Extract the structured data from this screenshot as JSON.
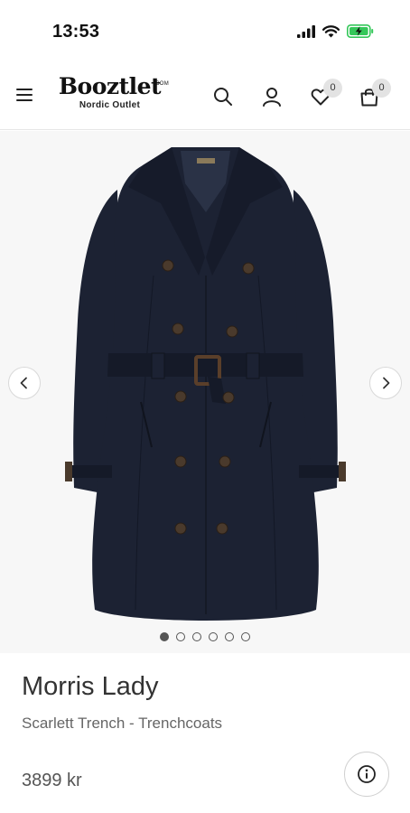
{
  "status_bar": {
    "time": "13:53",
    "icons": [
      "signal-icon",
      "wifi-icon",
      "battery-charging-icon"
    ],
    "battery_color": "#34c759"
  },
  "header": {
    "logo_text": "Booztlet",
    "logo_com": ".COM",
    "logo_subtitle": "Nordic Outlet",
    "wishlist_count": "0",
    "cart_count": "0",
    "icons": [
      "menu-icon",
      "search-icon",
      "account-icon",
      "heart-icon",
      "bag-icon"
    ]
  },
  "gallery": {
    "image_alt": "navy trench coat",
    "coat_color": "#1c2233",
    "background": "#f7f7f7",
    "dot_count": 6,
    "active_dot": 0
  },
  "product": {
    "brand": "Morris Lady",
    "name": "Scarlett Trench - Trenchcoats",
    "price": "3899 kr"
  }
}
